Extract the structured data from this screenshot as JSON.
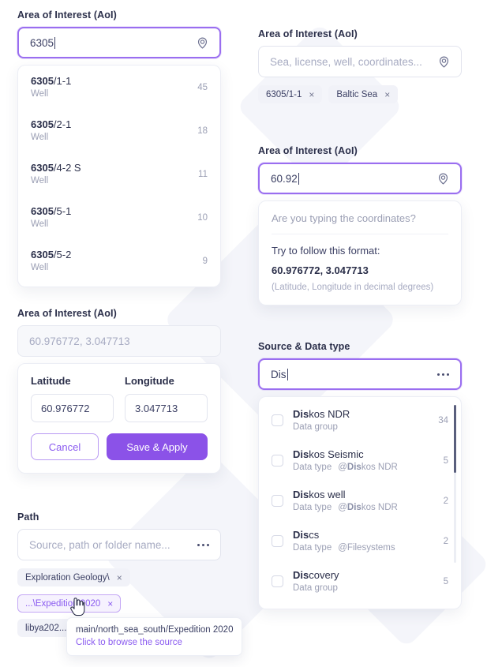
{
  "aoi_typing": {
    "label": "Area of Interest (AoI)",
    "value": "6305",
    "icon": "map-pin-icon",
    "suggestions": [
      {
        "match": "6305",
        "rest": "/1-1",
        "type": "Well",
        "count": "45"
      },
      {
        "match": "6305",
        "rest": "/2-1",
        "type": "Well",
        "count": "18"
      },
      {
        "match": "6305",
        "rest": "/4-2 S",
        "type": "Well",
        "count": "11"
      },
      {
        "match": "6305",
        "rest": "/5-1",
        "type": "Well",
        "count": "10"
      },
      {
        "match": "6305",
        "rest": "/5-2",
        "type": "Well",
        "count": "9"
      }
    ]
  },
  "aoi_chips": {
    "label": "Area of Interest (AoI)",
    "placeholder": "Sea, license, well, coordinates...",
    "icon": "map-pin-icon",
    "chips": [
      {
        "label": "6305/1-1",
        "remove": "×"
      },
      {
        "label": "Baltic Sea",
        "remove": "×"
      }
    ]
  },
  "aoi_coords": {
    "label": "Area of Interest (AoI)",
    "value": "60.92",
    "icon": "map-pin-icon",
    "hint": {
      "question": "Are you typing the coordinates?",
      "format_label": "Try to follow this format:",
      "format_example": "60.976772, 3.047713",
      "note": "(Latitude, Longitude in decimal degrees)"
    }
  },
  "aoi_latlong": {
    "label": "Area of Interest (AoI)",
    "readonly_value": "60.976772, 3.047713",
    "latitude_label": "Latitude",
    "latitude_value": "60.976772",
    "longitude_label": "Longitude",
    "longitude_value": "3.047713",
    "cancel_label": "Cancel",
    "save_label": "Save & Apply"
  },
  "source_data_type": {
    "label": "Source & Data type",
    "value": "Dis",
    "icon": "ellipsis-icon",
    "options": [
      {
        "match": "Dis",
        "rest": "kos NDR",
        "kind": "Data group",
        "at": "",
        "at_match": "",
        "at_rest": "",
        "count": "34"
      },
      {
        "match": "Dis",
        "rest": "kos Seismic",
        "kind": "Data type",
        "at": "@",
        "at_match": "Dis",
        "at_rest": "kos NDR",
        "count": "5"
      },
      {
        "match": "Dis",
        "rest": "kos well",
        "kind": "Data type",
        "at": "@",
        "at_match": "Dis",
        "at_rest": "kos NDR",
        "count": "2"
      },
      {
        "match": "Dis",
        "rest": "cs",
        "kind": "Data type",
        "at": "@",
        "at_match": "",
        "at_rest": "Filesystems",
        "count": "2"
      },
      {
        "match": "Dis",
        "rest": "covery",
        "kind": "Data group",
        "at": "",
        "at_match": "",
        "at_rest": "",
        "count": "5"
      }
    ]
  },
  "path": {
    "label": "Path",
    "placeholder": "Source, path or folder name...",
    "icon": "ellipsis-icon",
    "chips_row1": [
      {
        "label": "Exploration Geology\\",
        "remove": "×",
        "hover": false
      }
    ],
    "chips_row2": [
      {
        "label": "...\\Expedition 2020",
        "remove": "×",
        "hover": true
      },
      {
        "label": "libya202...und.sygy",
        "remove": "×",
        "hover": false
      }
    ],
    "tooltip": {
      "path": "main/north_sea_south/Expedition 2020",
      "action": "Click to browse the source"
    }
  },
  "colors": {
    "accent": "#8b52e8",
    "accent_light": "#9a6ef0",
    "text": "#2b2f4a",
    "muted": "#9b9fb4",
    "chip_bg": "#f1f2f8"
  }
}
